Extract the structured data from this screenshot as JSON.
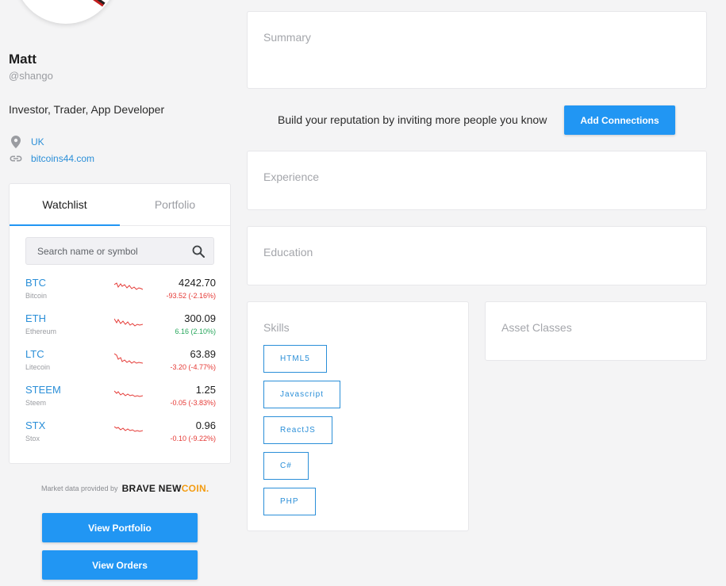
{
  "profile": {
    "name": "Matt",
    "handle": "@shango",
    "bio": "Investor, Trader, App Developer",
    "location": "UK",
    "website": "bitcoins44.com"
  },
  "watchlist": {
    "tabs": [
      "Watchlist",
      "Portfolio"
    ],
    "active_tab": "Watchlist",
    "search_placeholder": "Search name or symbol",
    "coins": [
      {
        "symbol": "BTC",
        "name": "Bitcoin",
        "price": "4242.70",
        "change": "-93.52 (-2.16%)",
        "direction": "down"
      },
      {
        "symbol": "ETH",
        "name": "Ethereum",
        "price": "300.09",
        "change": "6.16 (2.10%)",
        "direction": "up"
      },
      {
        "symbol": "LTC",
        "name": "Litecoin",
        "price": "63.89",
        "change": "-3.20 (-4.77%)",
        "direction": "down"
      },
      {
        "symbol": "STEEM",
        "name": "Steem",
        "price": "1.25",
        "change": "-0.05 (-3.83%)",
        "direction": "down"
      },
      {
        "symbol": "STX",
        "name": "Stox",
        "price": "0.96",
        "change": "-0.10 (-9.22%)",
        "direction": "down"
      }
    ],
    "provided_by": "Market data provided by",
    "provider_brand_a": "BRAVE NEW",
    "provider_brand_b": "COIN."
  },
  "buttons": {
    "view_portfolio": "View Portfolio",
    "view_orders": "View Orders",
    "add_connections": "Add Connections"
  },
  "sections": {
    "summary": "Summary",
    "invite_text": "Build your reputation by inviting more people you know",
    "experience": "Experience",
    "education": "Education",
    "skills": "Skills",
    "asset_classes": "Asset Classes"
  },
  "skills": [
    "HTML5",
    "Javascript",
    "ReactJS",
    "C#",
    "PHP"
  ],
  "colors": {
    "accent": "#2196f3",
    "link": "#2b8fd8",
    "negative": "#e53935",
    "positive": "#26a65b",
    "spark": "#e53935"
  },
  "icons": {
    "location": "location-pin-icon",
    "link": "link-icon",
    "search": "search-icon"
  }
}
